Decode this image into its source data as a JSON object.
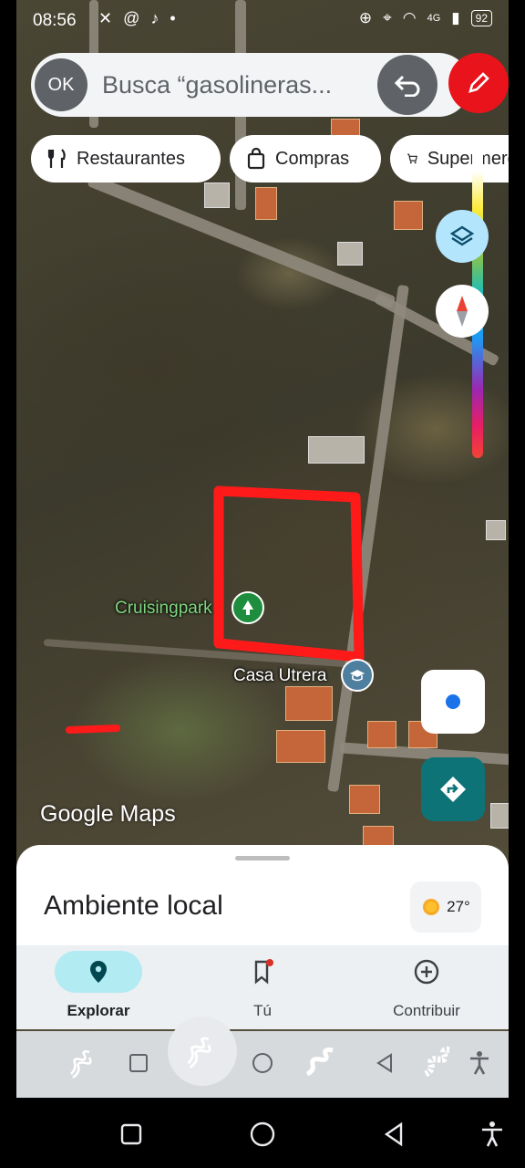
{
  "status_bar": {
    "time": "08:56",
    "network": "4G",
    "battery": "92"
  },
  "search": {
    "badge": "OK",
    "placeholder": "Busca “gasolineras..."
  },
  "chips": [
    {
      "label": "Restaurantes",
      "icon": "fork-knife-icon"
    },
    {
      "label": "Compras",
      "icon": "shopping-bag-icon"
    },
    {
      "label": "Supermercados",
      "icon": "cart-icon"
    }
  ],
  "map": {
    "places": [
      {
        "name": "Cruisingpark",
        "icon": "tree-pin-icon",
        "color": "#1e8e3e"
      },
      {
        "name": "Casa Utrera",
        "icon": "school-pin-icon",
        "color": "#4f7f9f"
      }
    ],
    "logo": "Google Maps",
    "annotation_color": "#ff1a1a"
  },
  "sheet": {
    "title": "Ambiente local",
    "temperature": "27°"
  },
  "bottom_nav": [
    {
      "label": "Explorar",
      "icon": "location-pin-icon",
      "active": true
    },
    {
      "label": "Tú",
      "icon": "bookmark-icon",
      "active": false
    },
    {
      "label": "Contribuir",
      "icon": "add-circle-icon",
      "active": false
    }
  ],
  "colors": {
    "accent": "#00796b",
    "fab_teal": "#0d7377",
    "edit_red": "#e8131b"
  }
}
